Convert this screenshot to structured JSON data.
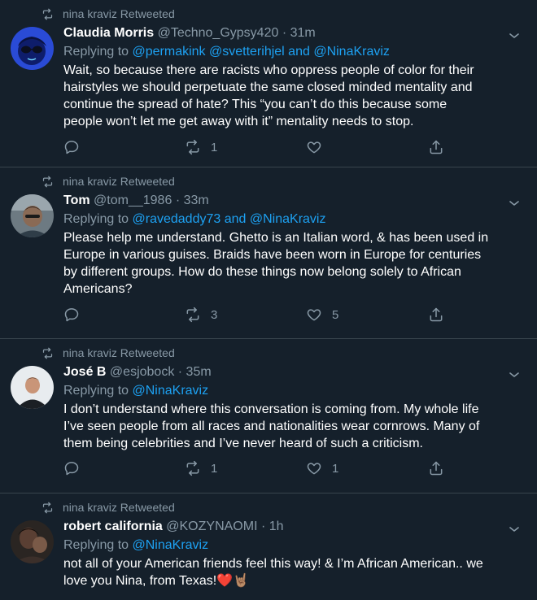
{
  "tweets": [
    {
      "retweeted_by": "nina kraviz Retweeted",
      "name": "Claudia Morris",
      "handle": "@Techno_Gypsy420",
      "dot": "·",
      "time": "31m",
      "replying_prefix": "Replying to",
      "mentions": [
        "@permakink",
        "@svetterihjel",
        "and",
        "@NinaKraviz"
      ],
      "text": "Wait, so because there are racists who oppress people of color for their\nhairstyles we should perpetuate the same closed minded mentality and\ncontinue the spread of hate? This “you can’t do this because some\npeople won’t let me get away with it” mentality needs to stop.",
      "replies": "",
      "retweets": "1",
      "likes": ""
    },
    {
      "retweeted_by": "nina kraviz Retweeted",
      "name": "Tom",
      "handle": "@tom__1986",
      "dot": "·",
      "time": "33m",
      "replying_prefix": "Replying to",
      "mentions": [
        "@ravedaddy73",
        "and",
        "@NinaKraviz"
      ],
      "text": "Please help me understand. Ghetto is an Italian word, & has been used in\nEurope in various guises. Braids have been worn in Europe for centuries\nby different groups. How do these things now belong solely to African\nAmericans?",
      "replies": "",
      "retweets": "3",
      "likes": "5"
    },
    {
      "retweeted_by": "nina kraviz Retweeted",
      "name": "José B",
      "handle": "@esjobock",
      "dot": "·",
      "time": "35m",
      "replying_prefix": "Replying to",
      "mentions": [
        "@NinaKraviz"
      ],
      "text": "I don’t understand where this conversation is coming from. My whole life\nI’ve seen people from all races and nationalities wear cornrows. Many of\nthem being celebrities and I’ve never heard of such a criticism.",
      "replies": "",
      "retweets": "1",
      "likes": "1"
    },
    {
      "retweeted_by": "nina kraviz Retweeted",
      "name": "robert california",
      "handle": "@KOZYNAOMI",
      "dot": "·",
      "time": "1h",
      "replying_prefix": "Replying to",
      "mentions": [
        "@NinaKraviz"
      ],
      "text": "not all of your American friends feel this way! & I’m African American.. we\nlove you Nina, from Texas!❤️🤘🏽"
    }
  ],
  "colors": {
    "background": "#15202b",
    "divider": "#38444d",
    "secondary_text": "#8899a6",
    "link": "#1da1f2",
    "primary_text": "#ffffff"
  },
  "icons": [
    "retweet-icon",
    "chevron-down-icon",
    "reply-icon",
    "like-icon",
    "share-icon"
  ]
}
